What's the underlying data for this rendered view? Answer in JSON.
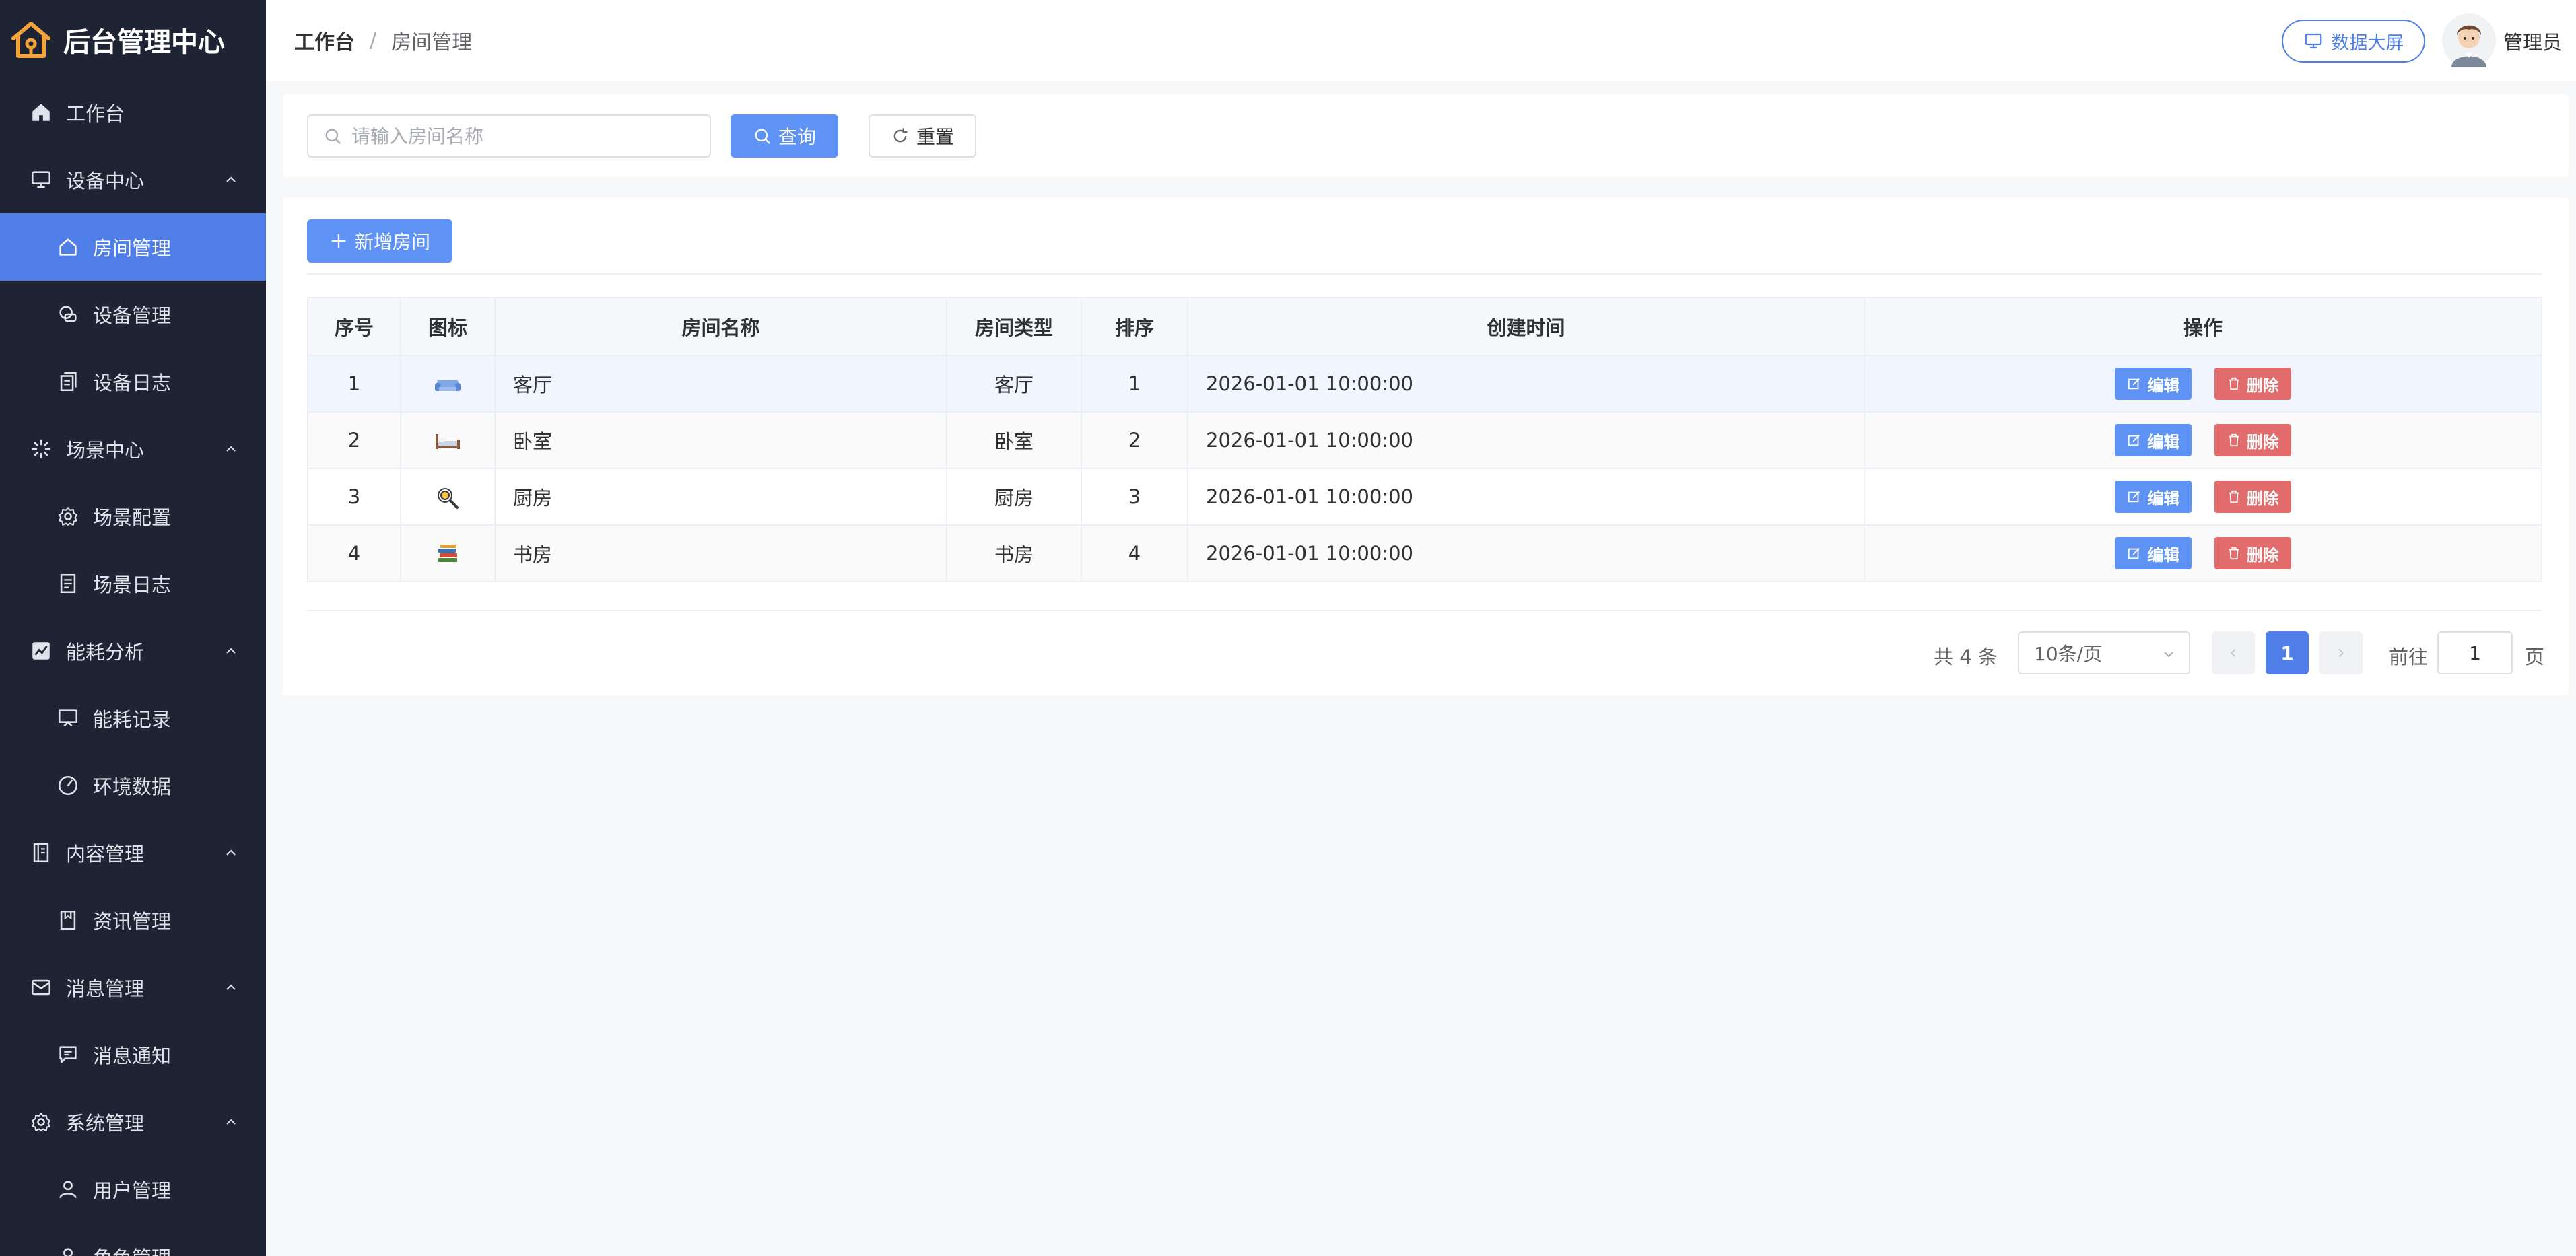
{
  "brand": {
    "title": "后台管理中心"
  },
  "sidebar": {
    "items": [
      {
        "label": "工作台",
        "type": "top"
      },
      {
        "label": "设备中心",
        "type": "group"
      },
      {
        "label": "房间管理",
        "type": "sub",
        "active": true
      },
      {
        "label": "设备管理",
        "type": "sub"
      },
      {
        "label": "设备日志",
        "type": "sub"
      },
      {
        "label": "场景中心",
        "type": "group"
      },
      {
        "label": "场景配置",
        "type": "sub"
      },
      {
        "label": "场景日志",
        "type": "sub"
      },
      {
        "label": "能耗分析",
        "type": "group"
      },
      {
        "label": "能耗记录",
        "type": "sub"
      },
      {
        "label": "环境数据",
        "type": "sub"
      },
      {
        "label": "内容管理",
        "type": "group"
      },
      {
        "label": "资讯管理",
        "type": "sub"
      },
      {
        "label": "消息管理",
        "type": "group"
      },
      {
        "label": "消息通知",
        "type": "sub"
      },
      {
        "label": "系统管理",
        "type": "group"
      },
      {
        "label": "用户管理",
        "type": "sub"
      },
      {
        "label": "角色管理",
        "type": "sub"
      }
    ]
  },
  "header": {
    "breadcrumb_root": "工作台",
    "breadcrumb_sep": "/",
    "breadcrumb_current": "房间管理",
    "data_screen_label": "数据大屏",
    "user_name": "管理员"
  },
  "search": {
    "placeholder": "请输入房间名称",
    "query_label": "查询",
    "reset_label": "重置"
  },
  "toolbar": {
    "add_label": "新增房间"
  },
  "table": {
    "columns": [
      "序号",
      "图标",
      "房间名称",
      "房间类型",
      "排序",
      "创建时间",
      "操作"
    ],
    "rows": [
      {
        "index": "1",
        "icon": "sofa-icon",
        "name": "客厅",
        "type": "客厅",
        "sort": "1",
        "created": "2026-01-01 10:00:00"
      },
      {
        "index": "2",
        "icon": "bed-icon",
        "name": "卧室",
        "type": "卧室",
        "sort": "2",
        "created": "2026-01-01 10:00:00"
      },
      {
        "index": "3",
        "icon": "frying-pan-icon",
        "name": "厨房",
        "type": "厨房",
        "sort": "3",
        "created": "2026-01-01 10:00:00"
      },
      {
        "index": "4",
        "icon": "books-icon",
        "name": "书房",
        "type": "书房",
        "sort": "4",
        "created": "2026-01-01 10:00:00"
      }
    ],
    "edit_label": "编辑",
    "delete_label": "删除"
  },
  "pagination": {
    "total_text": "共 4 条",
    "page_size": "10条/页",
    "current_page": "1",
    "goto_label": "前往",
    "goto_value": "1",
    "page_suffix": "页"
  },
  "colors": {
    "sidebar_bg": "#1e2433",
    "accent": "#4f7ee8",
    "primary_button": "#5e93f5",
    "danger": "#e26b6b"
  }
}
